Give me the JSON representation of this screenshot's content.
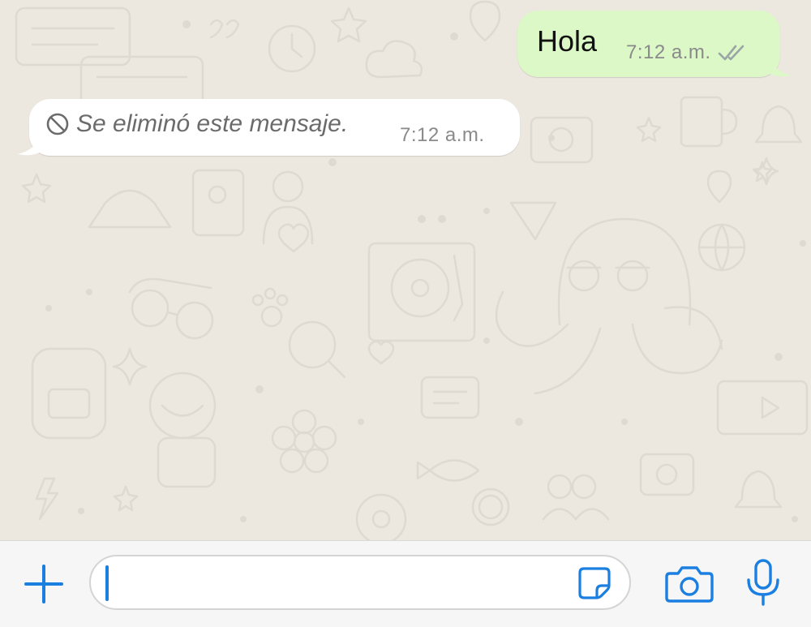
{
  "chat": {
    "messages": [
      {
        "direction": "outgoing",
        "text": "Hola",
        "time": "7:12 a.m.",
        "status_icon": "double-check-icon"
      },
      {
        "direction": "incoming",
        "text": "Se eliminó este mensaje.",
        "time": "7:12 a.m.",
        "status_icon": "blocked-icon",
        "deleted": true
      }
    ]
  },
  "input_bar": {
    "plus_icon": "plus-icon",
    "message_value": "",
    "sticker_icon": "sticker-icon",
    "camera_icon": "camera-icon",
    "mic_icon": "microphone-icon"
  },
  "colors": {
    "accent": "#1a7fe1",
    "outgoing_bubble": "#dcf8c6",
    "incoming_bubble": "#ffffff",
    "chat_background": "#ece8e0",
    "input_bar_background": "#f6f6f6"
  }
}
